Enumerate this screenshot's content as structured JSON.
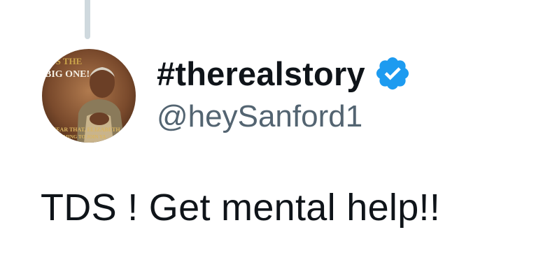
{
  "colors": {
    "text_primary": "#0f1419",
    "text_secondary": "#536471",
    "verified_blue": "#1d9bf0",
    "thread_line": "#cfd9de"
  },
  "author": {
    "display_name": "#therealstory",
    "handle": "@heySanford1",
    "verified_icon": "verified-badge-icon",
    "avatar": {
      "alt_icon": "profile-avatar",
      "text_top_1": "'S THE",
      "text_top_2": "BIG ONE!",
      "text_bottom_1": "HEAR THAT, ELIZABETH",
      "text_bottom_2": "COMING TO JOIN YA"
    }
  },
  "tweet": {
    "text": "TDS ! Get mental help!!"
  }
}
